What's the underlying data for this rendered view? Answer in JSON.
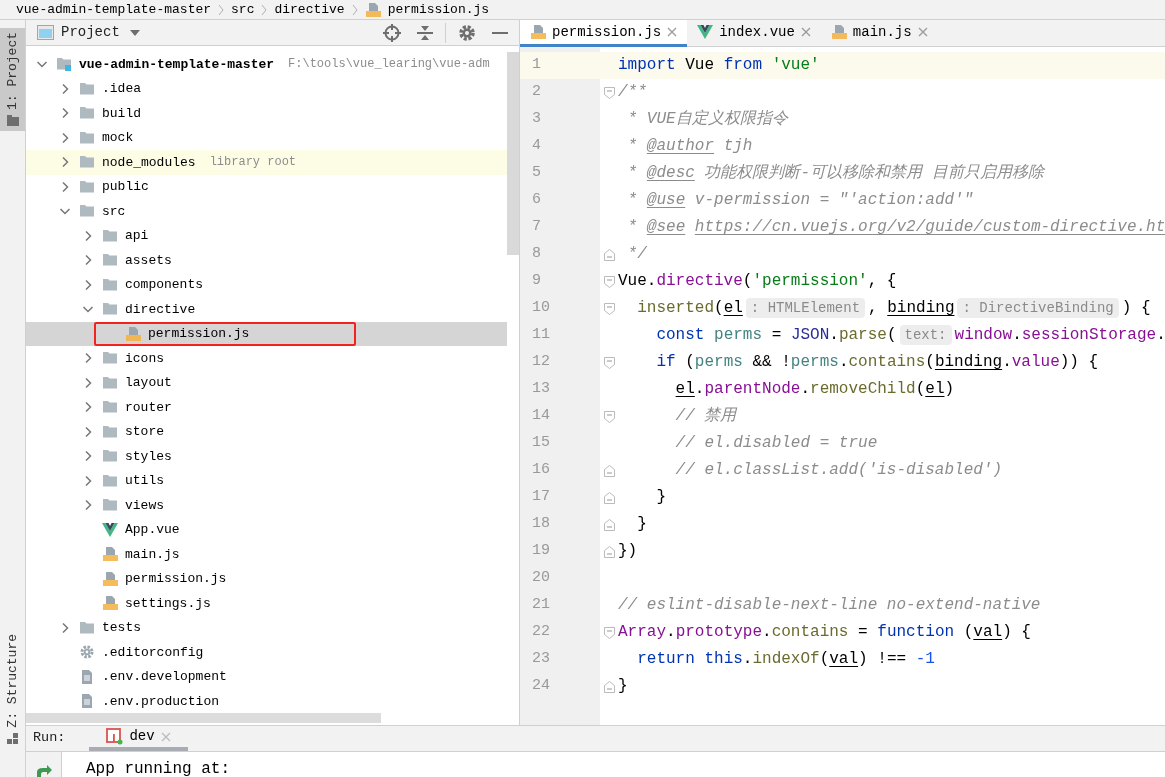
{
  "breadcrumb": [
    {
      "label": "vue-admin-template-master",
      "kind": "module"
    },
    {
      "label": "src",
      "kind": "folder"
    },
    {
      "label": "directive",
      "kind": "folder"
    },
    {
      "label": "permission.js",
      "kind": "js"
    }
  ],
  "tool_stripe": [
    {
      "label": "1: Project",
      "selected": true,
      "kind": "project"
    },
    {
      "label": "Z: Structure",
      "selected": false,
      "kind": "structure"
    }
  ],
  "project_panel": {
    "title": "Project",
    "tree": [
      {
        "label": "vue-admin-template-master",
        "kind": "module",
        "hint": "F:\\tools\\vue_learing\\vue-adm",
        "expanded": true,
        "selected": false,
        "marked": false,
        "children": [
          {
            "label": ".idea",
            "kind": "folder",
            "expanded": false,
            "selected": false,
            "marked": false
          },
          {
            "label": "build",
            "kind": "folder",
            "expanded": false,
            "selected": false,
            "marked": false
          },
          {
            "label": "mock",
            "kind": "folder",
            "expanded": false,
            "selected": false,
            "marked": false
          },
          {
            "label": "node_modules",
            "kind": "library",
            "hint": "library root",
            "expanded": false,
            "selected": false,
            "marked": false
          },
          {
            "label": "public",
            "kind": "folder",
            "expanded": false,
            "selected": false,
            "marked": false
          },
          {
            "label": "src",
            "kind": "folder",
            "expanded": true,
            "selected": false,
            "marked": false,
            "children": [
              {
                "label": "api",
                "kind": "folder",
                "expanded": false,
                "selected": false,
                "marked": false
              },
              {
                "label": "assets",
                "kind": "folder",
                "expanded": false,
                "selected": false,
                "marked": false
              },
              {
                "label": "components",
                "kind": "folder",
                "expanded": false,
                "selected": false,
                "marked": false
              },
              {
                "label": "directive",
                "kind": "folder",
                "expanded": true,
                "selected": false,
                "marked": false,
                "children": [
                  {
                    "label": "permission.js",
                    "kind": "js",
                    "selected": true,
                    "marked": true
                  }
                ]
              },
              {
                "label": "icons",
                "kind": "folder",
                "expanded": false,
                "selected": false,
                "marked": false
              },
              {
                "label": "layout",
                "kind": "folder",
                "expanded": false,
                "selected": false,
                "marked": false
              },
              {
                "label": "router",
                "kind": "folder",
                "expanded": false,
                "selected": false,
                "marked": false
              },
              {
                "label": "store",
                "kind": "folder",
                "expanded": false,
                "selected": false,
                "marked": false
              },
              {
                "label": "styles",
                "kind": "folder",
                "expanded": false,
                "selected": false,
                "marked": false
              },
              {
                "label": "utils",
                "kind": "folder",
                "expanded": false,
                "selected": false,
                "marked": false
              },
              {
                "label": "views",
                "kind": "folder",
                "expanded": false,
                "selected": false,
                "marked": false
              },
              {
                "label": "App.vue",
                "kind": "vue",
                "selected": false,
                "marked": false
              },
              {
                "label": "main.js",
                "kind": "js",
                "selected": false,
                "marked": false
              },
              {
                "label": "permission.js",
                "kind": "js",
                "selected": false,
                "marked": false
              },
              {
                "label": "settings.js",
                "kind": "js",
                "selected": false,
                "marked": false
              }
            ]
          },
          {
            "label": "tests",
            "kind": "folder",
            "expanded": false,
            "selected": false,
            "marked": false
          },
          {
            "label": ".editorconfig",
            "kind": "config",
            "selected": false,
            "marked": false
          },
          {
            "label": ".env.development",
            "kind": "text",
            "selected": false,
            "marked": false
          },
          {
            "label": ".env.production",
            "kind": "text",
            "selected": false,
            "marked": false
          }
        ]
      }
    ]
  },
  "editor": {
    "tabs": [
      {
        "label": "permission.js",
        "kind": "js",
        "selected": true
      },
      {
        "label": "index.vue",
        "kind": "vue",
        "selected": false
      },
      {
        "label": "main.js",
        "kind": "js",
        "selected": false
      }
    ],
    "lines": [
      {
        "number": "1",
        "current": true,
        "kind": "plain",
        "tokens": [
          {
            "kind": "keyword",
            "text": "import"
          },
          {
            "kind": "plain",
            "text": " Vue "
          },
          {
            "kind": "keyword",
            "text": "from"
          },
          {
            "kind": "string",
            "text": " 'vue'"
          }
        ]
      },
      {
        "number": "2",
        "current": false,
        "kind": "opener",
        "tokens": [
          {
            "kind": "comment",
            "text": "/**"
          }
        ]
      },
      {
        "number": "3",
        "current": false,
        "kind": "plain",
        "tokens": [
          {
            "kind": "comment",
            "text": " * VUE自定义权限指令"
          }
        ]
      },
      {
        "number": "4",
        "current": false,
        "kind": "plain",
        "tokens": [
          {
            "kind": "comment",
            "text": " * "
          },
          {
            "kind": "doctag",
            "text": "@author"
          },
          {
            "kind": "comment",
            "text": " tjh"
          }
        ]
      },
      {
        "number": "5",
        "current": false,
        "kind": "plain",
        "tokens": [
          {
            "kind": "comment",
            "text": " * "
          },
          {
            "kind": "doctag",
            "text": "@desc"
          },
          {
            "kind": "comment",
            "text": " 功能权限判断-可以移除和禁用 目前只启用移除"
          }
        ]
      },
      {
        "number": "6",
        "current": false,
        "kind": "plain",
        "tokens": [
          {
            "kind": "comment",
            "text": " * "
          },
          {
            "kind": "doctag",
            "text": "@use"
          },
          {
            "kind": "comment",
            "text": " v-permission = \"'action:add'\""
          }
        ]
      },
      {
        "number": "7",
        "current": false,
        "kind": "plain",
        "tokens": [
          {
            "kind": "comment",
            "text": " * "
          },
          {
            "kind": "doctag",
            "text": "@see"
          },
          {
            "kind": "link",
            "text": " https://cn.vuejs.org/v2/guide/custom-directive.ht"
          }
        ]
      },
      {
        "number": "8",
        "current": false,
        "kind": "closer",
        "tokens": [
          {
            "kind": "comment",
            "text": " */"
          }
        ]
      },
      {
        "number": "9",
        "current": false,
        "kind": "opener",
        "tokens": [
          {
            "kind": "plain",
            "text": "Vue."
          },
          {
            "kind": "member",
            "text": "directive"
          },
          {
            "kind": "plain",
            "text": "("
          },
          {
            "kind": "string",
            "text": "'permission'"
          },
          {
            "kind": "plain",
            "text": ", {"
          }
        ]
      },
      {
        "number": "10",
        "current": false,
        "kind": "opener",
        "tokens": [
          {
            "kind": "method",
            "text": "  inserted"
          },
          {
            "kind": "plain",
            "text": "("
          },
          {
            "kind": "param",
            "text": "el"
          },
          {
            "kind": "hint",
            "text": ": HTMLElement"
          },
          {
            "kind": "plain",
            "text": ", "
          },
          {
            "kind": "param",
            "text": "binding"
          },
          {
            "kind": "hint",
            "text": ": DirectiveBinding"
          },
          {
            "kind": "plain",
            "text": ") {"
          }
        ]
      },
      {
        "number": "11",
        "current": false,
        "kind": "plain",
        "tokens": [
          {
            "kind": "keyword",
            "text": "    const"
          },
          {
            "kind": "local",
            "text": " perms"
          },
          {
            "kind": "plain",
            "text": " = "
          },
          {
            "kind": "global",
            "text": "JSON"
          },
          {
            "kind": "plain",
            "text": "."
          },
          {
            "kind": "method",
            "text": "parse"
          },
          {
            "kind": "plain",
            "text": "("
          },
          {
            "kind": "hint",
            "text": "text:"
          },
          {
            "kind": "member",
            "text": "window"
          },
          {
            "kind": "plain",
            "text": "."
          },
          {
            "kind": "member",
            "text": "sessionStorage"
          },
          {
            "kind": "plain",
            "text": "."
          }
        ]
      },
      {
        "number": "12",
        "current": false,
        "kind": "opener",
        "tokens": [
          {
            "kind": "keyword",
            "text": "    if"
          },
          {
            "kind": "plain",
            "text": " ("
          },
          {
            "kind": "local",
            "text": "perms"
          },
          {
            "kind": "plain",
            "text": " && !"
          },
          {
            "kind": "local",
            "text": "perms"
          },
          {
            "kind": "plain",
            "text": "."
          },
          {
            "kind": "method",
            "text": "contains"
          },
          {
            "kind": "plain",
            "text": "("
          },
          {
            "kind": "param",
            "text": "binding"
          },
          {
            "kind": "plain",
            "text": "."
          },
          {
            "kind": "member",
            "text": "value"
          },
          {
            "kind": "plain",
            "text": ")) {"
          }
        ]
      },
      {
        "number": "13",
        "current": false,
        "kind": "plain",
        "tokens": [
          {
            "kind": "param",
            "text": "      el"
          },
          {
            "kind": "plain",
            "text": "."
          },
          {
            "kind": "member",
            "text": "parentNode"
          },
          {
            "kind": "plain",
            "text": "."
          },
          {
            "kind": "method",
            "text": "removeChild"
          },
          {
            "kind": "plain",
            "text": "("
          },
          {
            "kind": "param",
            "text": "el"
          },
          {
            "kind": "plain",
            "text": ")"
          }
        ]
      },
      {
        "number": "14",
        "current": false,
        "kind": "opener",
        "tokens": [
          {
            "kind": "comment",
            "text": "      // 禁用"
          }
        ]
      },
      {
        "number": "15",
        "current": false,
        "kind": "plain",
        "tokens": [
          {
            "kind": "comment",
            "text": "      // el.disabled = true"
          }
        ]
      },
      {
        "number": "16",
        "current": false,
        "kind": "closer",
        "tokens": [
          {
            "kind": "comment",
            "text": "      // el.classList.add('is-disabled')"
          }
        ]
      },
      {
        "number": "17",
        "current": false,
        "kind": "closer",
        "tokens": [
          {
            "kind": "plain",
            "text": "    }"
          }
        ]
      },
      {
        "number": "18",
        "current": false,
        "kind": "closer",
        "tokens": [
          {
            "kind": "plain",
            "text": "  }"
          }
        ]
      },
      {
        "number": "19",
        "current": false,
        "kind": "closer",
        "tokens": [
          {
            "kind": "plain",
            "text": "})"
          }
        ]
      },
      {
        "number": "20",
        "current": false,
        "kind": "plain"
      },
      {
        "number": "21",
        "current": false,
        "kind": "plain",
        "tokens": [
          {
            "kind": "comment",
            "text": "// eslint-disable-next-line no-extend-native"
          }
        ]
      },
      {
        "number": "22",
        "current": false,
        "kind": "opener",
        "tokens": [
          {
            "kind": "member",
            "text": "Array"
          },
          {
            "kind": "plain",
            "text": "."
          },
          {
            "kind": "member",
            "text": "prototype"
          },
          {
            "kind": "plain",
            "text": "."
          },
          {
            "kind": "method",
            "text": "contains"
          },
          {
            "kind": "plain",
            "text": " = "
          },
          {
            "kind": "keyword",
            "text": "function"
          },
          {
            "kind": "plain",
            "text": " ("
          },
          {
            "kind": "param",
            "text": "val"
          },
          {
            "kind": "plain",
            "text": ") {"
          }
        ]
      },
      {
        "number": "23",
        "current": false,
        "kind": "plain",
        "tokens": [
          {
            "kind": "keyword",
            "text": "  return"
          },
          {
            "kind": "keyword",
            "text": " this"
          },
          {
            "kind": "plain",
            "text": "."
          },
          {
            "kind": "method",
            "text": "indexOf"
          },
          {
            "kind": "plain",
            "text": "("
          },
          {
            "kind": "param",
            "text": "val"
          },
          {
            "kind": "plain",
            "text": ") !== "
          },
          {
            "kind": "number",
            "text": "-1"
          }
        ]
      },
      {
        "number": "24",
        "current": false,
        "kind": "closer",
        "tokens": [
          {
            "kind": "plain",
            "text": "}"
          }
        ]
      }
    ]
  },
  "run_panel": {
    "label": "Run:",
    "tabs": [
      {
        "label": "dev",
        "selected": true
      }
    ],
    "console": [
      "App running at:"
    ]
  }
}
